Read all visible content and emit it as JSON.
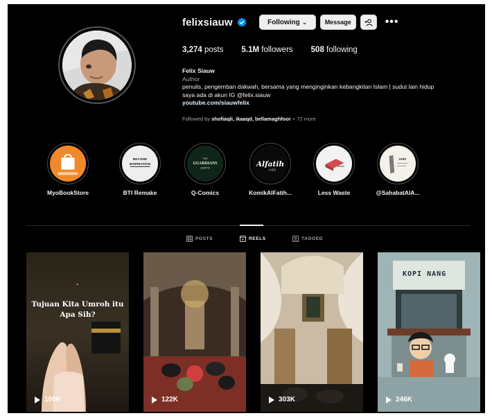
{
  "profile": {
    "username": "felixsiauw",
    "following_label": "Following",
    "message_label": "Message",
    "more_label": "•••",
    "stats": {
      "posts": "3,274",
      "posts_label": "posts",
      "followers": "5.1M",
      "followers_label": "followers",
      "following": "508",
      "following_label": "following"
    },
    "bio": {
      "name": "Felix Siauw",
      "category": "Author",
      "text_line1": "penulis, pengemban dakwah, bersama yang menginginkan kebangkitan Islam | sudut lain hidup",
      "text_line2": "saya ada di akun IG @felix.siauw",
      "link": "youtube.com/siauwfelix"
    },
    "followed_by": {
      "prefix": "Followed by",
      "names": "shofiaqli, ikaaqd, bellamaghfoor",
      "more": "+ 72 more"
    }
  },
  "highlights": [
    {
      "label": "MyoBookStore",
      "inner_text": "MyoBookStore"
    },
    {
      "label": "BTI Remake",
      "inner_text": "BEYOND THE INSPIRATION"
    },
    {
      "label": "Q-Comics",
      "inner_text": "THE GUARDIANS OF THE EARTH"
    },
    {
      "label": "KomikAlFatih...",
      "inner_text": "Alfatih 1453"
    },
    {
      "label": "Less Waste",
      "inner_text": ""
    },
    {
      "label": "@SahabatAlA...",
      "inner_text": "1990"
    }
  ],
  "tabs": [
    {
      "label": "POSTS",
      "icon": "grid-icon",
      "active": false
    },
    {
      "label": "REELS",
      "icon": "reels-icon",
      "active": true
    },
    {
      "label": "TAGGED",
      "icon": "tagged-icon",
      "active": false
    }
  ],
  "reels": [
    {
      "views": "100K",
      "caption": "Tujuan Kita Umroh itu Apa Sih?"
    },
    {
      "views": "122K"
    },
    {
      "views": "303K"
    },
    {
      "views": "246K",
      "title": "KOPI NANG"
    }
  ],
  "colors": {
    "background": "#000000",
    "verified_blue": "#0095f6",
    "button_bg": "#efefef",
    "muted_text": "#a8a8a8",
    "myobook_orange": "#f0892b"
  }
}
